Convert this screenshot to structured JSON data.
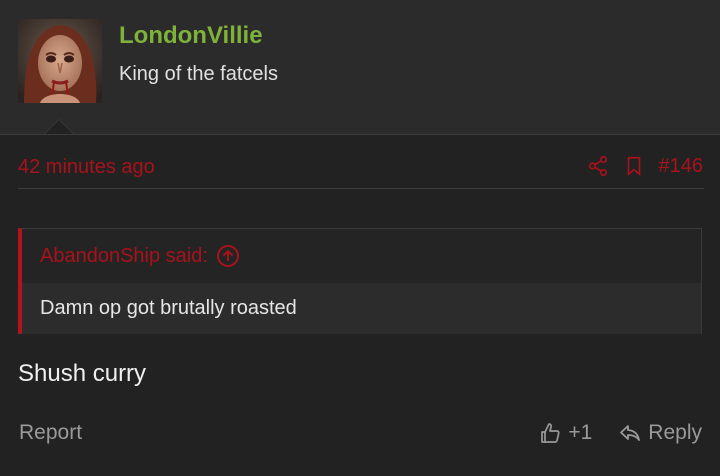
{
  "post": {
    "author": "LondonVillie",
    "user_title": "King of the fatcels",
    "time_ago": "42 minutes ago",
    "post_number": "#146",
    "quote": {
      "author_said": "AbandonShip said:",
      "text": "Damn op got brutally roasted"
    },
    "body": "Shush curry",
    "report_label": "Report",
    "like_count": "+1",
    "reply_label": "Reply"
  },
  "colors": {
    "background": "#222222",
    "username": "#7fb23a",
    "accent_red": "#a8121b",
    "muted": "#9a9a9a"
  },
  "icons": [
    "share-icon",
    "bookmark-icon",
    "arrow-up-circle-icon",
    "thumbs-up-icon",
    "reply-icon"
  ]
}
